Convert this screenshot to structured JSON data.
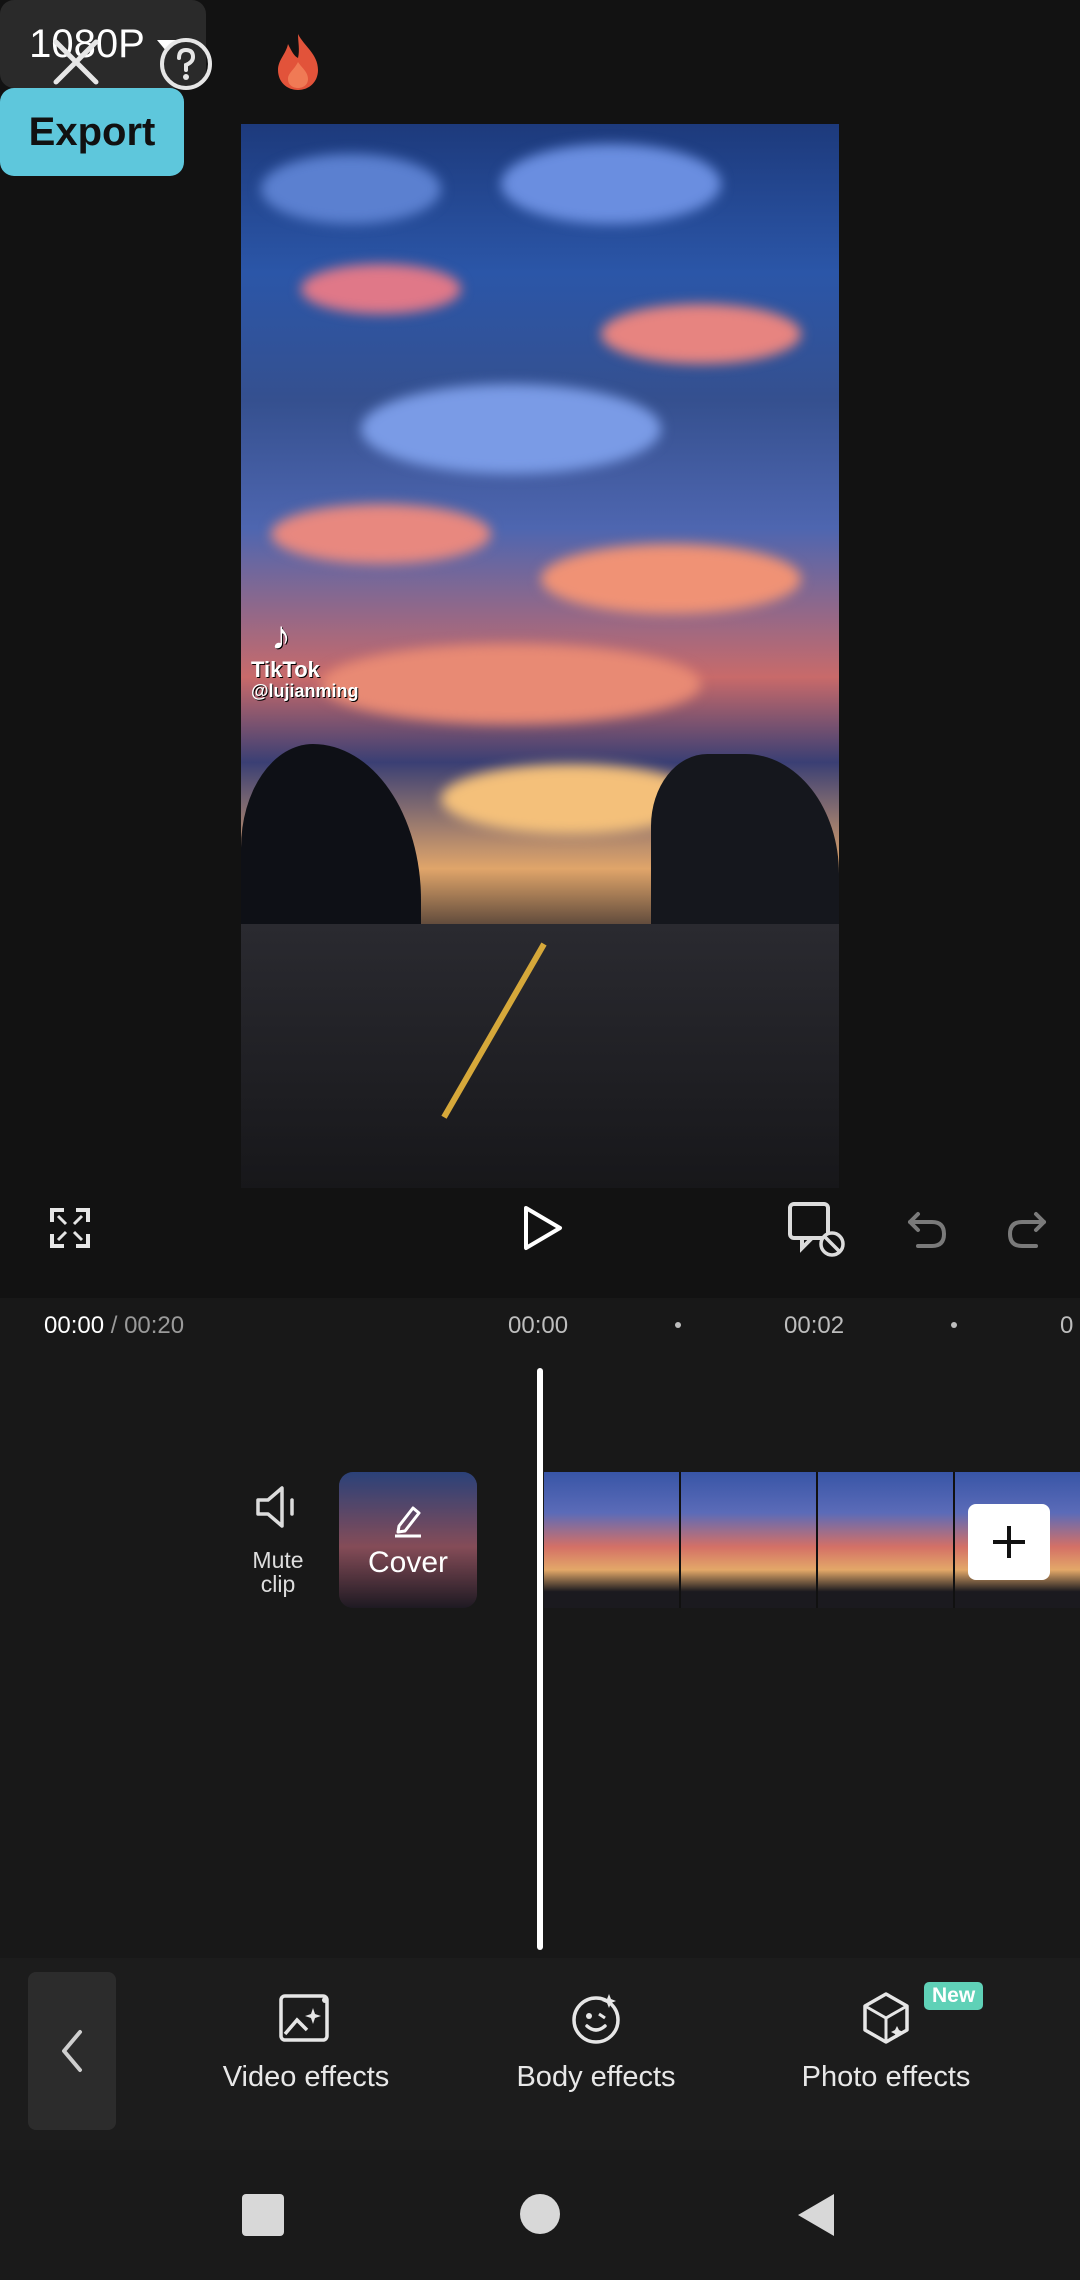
{
  "header": {
    "resolution": "1080P",
    "export_label": "Export"
  },
  "preview": {
    "watermark_brand": "TikTok",
    "watermark_handle": "@lujianming"
  },
  "timeline": {
    "current_time": "00:00",
    "total_time": "/ 00:20",
    "ruler": [
      "00:00",
      "00:02",
      "0"
    ],
    "mute_label": "Mute\nclip",
    "mute_label_line1": "Mute",
    "mute_label_line2": "clip",
    "cover_label": "Cover"
  },
  "toolbar": {
    "items": [
      {
        "label": "Video effects",
        "icon": "video-effects-icon"
      },
      {
        "label": "Body effects",
        "icon": "body-effects-icon"
      },
      {
        "label": "Photo effects",
        "icon": "photo-effects-icon",
        "badge": "New"
      }
    ]
  },
  "colors": {
    "accent": "#5ec7dc",
    "badge": "#5fd1b7",
    "flame": "#e2533a"
  }
}
